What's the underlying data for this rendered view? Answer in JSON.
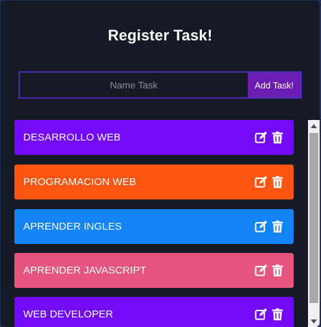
{
  "header": {
    "title": "Register Task!"
  },
  "form": {
    "placeholder": "Name Task",
    "value": "",
    "add_label": "Add Task!"
  },
  "tasks": [
    {
      "label": "DESARROLLO WEB",
      "color": "#7209f9"
    },
    {
      "label": "PROGRAMACION WEB",
      "color": "#fe5612"
    },
    {
      "label": "APRENDER INGLES",
      "color": "#1384f7"
    },
    {
      "label": "APRENDER JAVASCRIPT",
      "color": "#e5557f"
    },
    {
      "label": "WEB DEVELOPER",
      "color": "#7209f9"
    }
  ],
  "icons": {
    "edit": "edit-icon",
    "delete": "trash-icon"
  },
  "colors": {
    "background": "#161a27",
    "input_border": "#4a2bb3",
    "add_button": "#6a1bb0"
  }
}
